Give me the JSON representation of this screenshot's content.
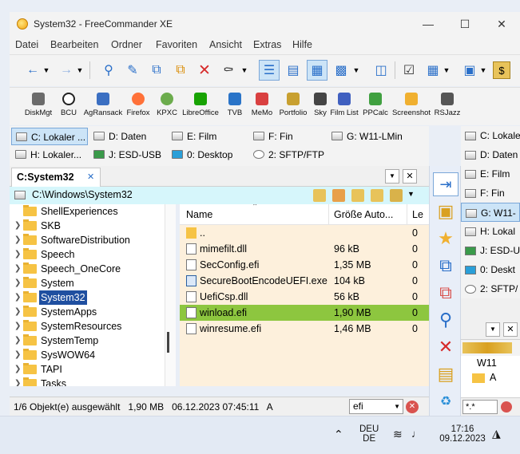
{
  "window": {
    "title": "System32 - FreeCommander XE",
    "minimize": "—",
    "maximize": "☐",
    "close": "✕"
  },
  "menu": [
    "Datei",
    "Bearbeiten",
    "Ordner",
    "Favoriten",
    "Ansicht",
    "Extras",
    "Hilfe"
  ],
  "toolbar_icons": [
    "back-icon",
    "forward-icon",
    "search-icon",
    "edit-icon",
    "copy-icon",
    "move-icon",
    "delete-icon",
    "binoculars-icon",
    "view-details-icon",
    "view-list-icon",
    "view-thumbnails-icon",
    "filter-icon",
    "compare-icon",
    "layout-icon",
    "sync-icon",
    "dollar-icon"
  ],
  "tools": [
    {
      "label": "DiskMgt",
      "color": "#6b6b6b"
    },
    {
      "label": "BCU",
      "color": "#222222"
    },
    {
      "label": "AgRansack",
      "color": "#3b6fc2"
    },
    {
      "label": "Firefox",
      "color": "#ff7139"
    },
    {
      "label": "KPXC",
      "color": "#6cac4d"
    },
    {
      "label": "LibreOffice",
      "color": "#18a303"
    },
    {
      "label": "TVB",
      "color": "#2a74c8"
    },
    {
      "label": "MeMo",
      "color": "#d94040"
    },
    {
      "label": "Portfolio",
      "color": "#c8a030"
    },
    {
      "label": "Sky",
      "color": "#444444"
    },
    {
      "label": "Film List",
      "color": "#4060c0"
    },
    {
      "label": "PPCalc",
      "color": "#40a040"
    },
    {
      "label": "Screenshot",
      "color": "#f0b030"
    },
    {
      "label": "RSJazz",
      "color": "#555555"
    }
  ],
  "drives_left": [
    {
      "label": "C: Lokaler ...",
      "selected": true
    },
    {
      "label": "D: Daten",
      "selected": false
    },
    {
      "label": "E: Film",
      "selected": false
    },
    {
      "label": "F: Fin",
      "selected": false
    },
    {
      "label": "G: W11-LMin",
      "selected": false
    },
    {
      "label": "H: Lokaler...",
      "selected": false
    },
    {
      "label": "J: ESD-USB",
      "selected": false
    },
    {
      "label": "0: Desktop",
      "selected": false
    },
    {
      "label": "2: SFTP/FTP",
      "selected": false
    }
  ],
  "left_tab": {
    "label": "C:System32",
    "close": "✕"
  },
  "path": "C:\\Windows\\System32",
  "tree": [
    "ShellExperiences",
    "SKB",
    "SoftwareDistribution",
    "Speech",
    "Speech_OneCore",
    "System",
    "System32",
    "SystemApps",
    "SystemResources",
    "SystemTemp",
    "SysWOW64",
    "TAPI",
    "Tasks"
  ],
  "tree_selected": "System32",
  "columns": {
    "name": "Name",
    "size": "Größe Auto...",
    "date": "Le"
  },
  "files": [
    {
      "name": "..",
      "size": "",
      "date": "0",
      "selected": false
    },
    {
      "name": "mimefilt.dll",
      "size": "96 kB",
      "date": "0",
      "selected": false
    },
    {
      "name": "SecConfig.efi",
      "size": "1,35 MB",
      "date": "0",
      "selected": false
    },
    {
      "name": "SecureBootEncodeUEFI.exe",
      "size": "104 kB",
      "date": "0",
      "selected": false
    },
    {
      "name": "UefiCsp.dll",
      "size": "56 kB",
      "date": "0",
      "selected": false
    },
    {
      "name": "winload.efi",
      "size": "1,90 MB",
      "date": "0",
      "selected": true
    },
    {
      "name": "winresume.efi",
      "size": "1,46 MB",
      "date": "0",
      "selected": false
    }
  ],
  "status": "1/6 Objekt(e) ausgewählt   1,90 MB   06.12.2023 07:45:11   A",
  "filter_value": "efi",
  "drives_right": [
    {
      "label": "C: Lokaler",
      "selected": false
    },
    {
      "label": "D: Daten",
      "selected": false
    },
    {
      "label": "E: Film",
      "selected": false
    },
    {
      "label": "F: Fin",
      "selected": false
    },
    {
      "label": "G: W11-",
      "selected": true
    },
    {
      "label": "H: Lokal",
      "selected": false
    },
    {
      "label": "J: ESD-U",
      "selected": false
    },
    {
      "label": "0: Deskt",
      "selected": false
    },
    {
      "label": "2: SFTP/",
      "selected": false
    }
  ],
  "right_pane": {
    "tab": "W11",
    "row": "A",
    "filter": "*.*"
  },
  "taskbar": {
    "lang_top": "DEU",
    "lang_bottom": "DE",
    "time": "17:16",
    "date": "09.12.2023"
  }
}
